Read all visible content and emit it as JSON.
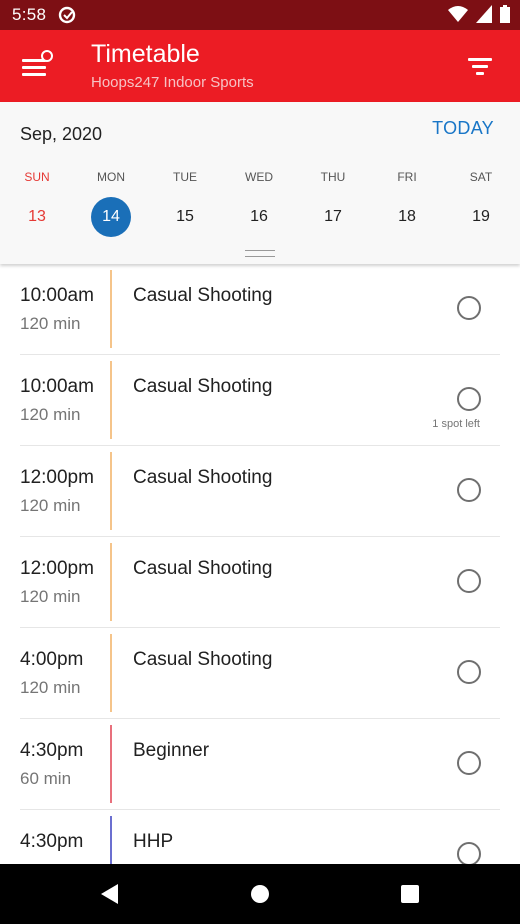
{
  "status_bar": {
    "time": "5:58"
  },
  "app_bar": {
    "title": "Timetable",
    "subtitle": "Hoops247 Indoor Sports",
    "menu_icon": "hamburger-menu-icon",
    "filter_icon": "filter-icon"
  },
  "calendar": {
    "month_label": "Sep, 2020",
    "today_label": "TODAY",
    "days": [
      {
        "name": "SUN",
        "num": "13",
        "sunday": true
      },
      {
        "name": "MON",
        "num": "14",
        "selected": true
      },
      {
        "name": "TUE",
        "num": "15"
      },
      {
        "name": "WED",
        "num": "16"
      },
      {
        "name": "THU",
        "num": "17"
      },
      {
        "name": "FRI",
        "num": "18"
      },
      {
        "name": "SAT",
        "num": "19"
      }
    ]
  },
  "sessions": [
    {
      "time": "10:00am",
      "duration": "120 min",
      "name": "Casual Shooting",
      "color": "#f5c48a"
    },
    {
      "time": "10:00am",
      "duration": "120 min",
      "name": "Casual Shooting",
      "color": "#f5c48a",
      "spots": "1 spot left"
    },
    {
      "time": "12:00pm",
      "duration": "120 min",
      "name": "Casual Shooting",
      "color": "#f5c48a"
    },
    {
      "time": "12:00pm",
      "duration": "120 min",
      "name": "Casual Shooting",
      "color": "#f5c48a"
    },
    {
      "time": "4:00pm",
      "duration": "120 min",
      "name": "Casual Shooting",
      "color": "#f5c48a"
    },
    {
      "time": "4:30pm",
      "duration": "60 min",
      "name": "Beginner",
      "color": "#e8707c"
    },
    {
      "time": "4:30pm",
      "duration": "",
      "name": "HHP",
      "color": "#6b6fd0"
    }
  ],
  "colors": {
    "status_bar": "#7d0f14",
    "app_bar": "#ec1c24",
    "accent": "#1a6fb8"
  }
}
